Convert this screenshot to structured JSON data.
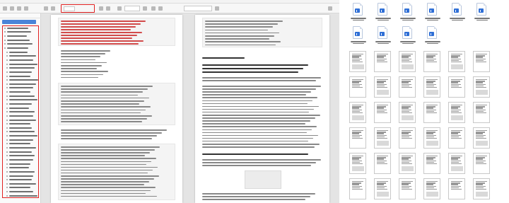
{
  "viewer": {
    "window_title": "",
    "toolbar": {
      "page_current": "",
      "page_total": "",
      "zoom": "",
      "search_placeholder": ""
    },
    "sidebar": {
      "title": "",
      "bookmarks": []
    },
    "pages": {
      "left_page_text": [],
      "right_page_text": []
    }
  },
  "file_browser": {
    "files": []
  },
  "colors": {
    "highlight_outline": "#e02020",
    "selection": "#4a84d8",
    "word_badge": "#2f6fd6"
  }
}
